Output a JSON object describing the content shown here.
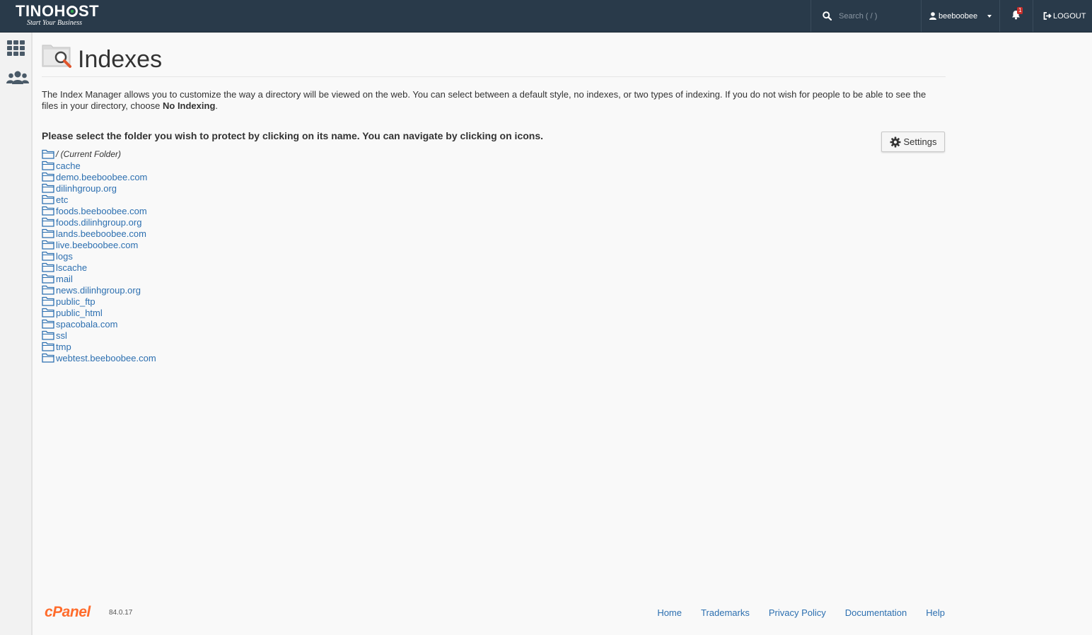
{
  "brand": {
    "name_left": "TINOH",
    "name_right": "ST",
    "tagline": "Start Your Business"
  },
  "topbar": {
    "search_placeholder": "Search ( / )",
    "username": "beeboobee",
    "notifications_count": "1",
    "logout_label": "LOGOUT"
  },
  "page": {
    "title": "Indexes",
    "description": "The Index Manager allows you to customize the way a directory will be viewed on the web. You can select between a default style, no indexes, or two types of indexing. If you do not wish for people to be able to see the files in your directory, choose ",
    "description_bold": "No Indexing",
    "description_end": ".",
    "instruction": "Please select the folder you wish to protect by clicking on its name. You can navigate by clicking on icons.",
    "settings_label": "Settings"
  },
  "folders": {
    "current": "/ (Current Folder)",
    "items": [
      "cache",
      "demo.beeboobee.com",
      "dilinhgroup.org",
      "etc",
      "foods.beeboobee.com",
      "foods.dilinhgroup.org",
      "lands.beeboobee.com",
      "live.beeboobee.com",
      "logs",
      "lscache",
      "mail",
      "news.dilinhgroup.org",
      "public_ftp",
      "public_html",
      "spacobala.com",
      "ssl",
      "tmp",
      "webtest.beeboobee.com"
    ]
  },
  "footer": {
    "logo": "cPanel",
    "version": "84.0.17",
    "links": [
      "Home",
      "Trademarks",
      "Privacy Policy",
      "Documentation",
      "Help"
    ]
  },
  "colors": {
    "topbar": "#293a4a",
    "link": "#2c6fb0",
    "cpanel_orange": "#ff6c2c",
    "badge": "#c9302c"
  },
  "icons": [
    "search-icon",
    "user-icon",
    "bell-icon",
    "logout-icon",
    "apps-grid-icon",
    "users-icon",
    "folder-search-icon",
    "gear-icon",
    "folder-icon"
  ]
}
